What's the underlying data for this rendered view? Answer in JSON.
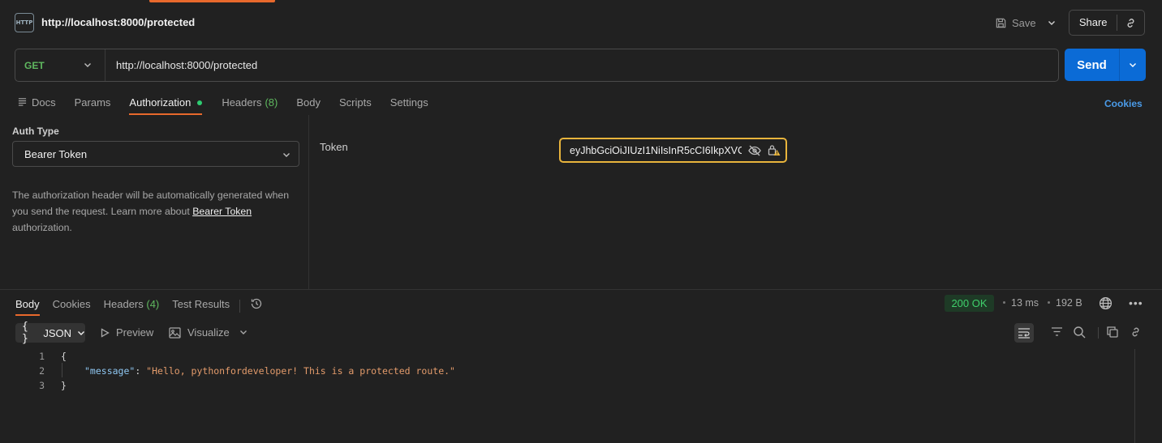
{
  "title_bar": {
    "icon_label": "HTTP",
    "request_name": "http://localhost:8000/protected",
    "save_label": "Save",
    "share_label": "Share"
  },
  "url_bar": {
    "method": "GET",
    "url": "http://localhost:8000/protected",
    "send_label": "Send"
  },
  "request_tabs": [
    {
      "label": "Docs"
    },
    {
      "label": "Params"
    },
    {
      "label": "Authorization"
    },
    {
      "label": "Headers",
      "count": "(8)"
    },
    {
      "label": "Body"
    },
    {
      "label": "Scripts"
    },
    {
      "label": "Settings"
    }
  ],
  "active_request_tab": "Authorization",
  "cookies_link": "Cookies",
  "auth": {
    "type_label": "Auth Type",
    "type_value": "Bearer Token",
    "desc_part1": "The authorization header will be automatically generated when you send the request. Learn more about ",
    "desc_link": "Bearer Token",
    "desc_part2": " authorization.",
    "token_label": "Token",
    "token_value": "eyJhbGciOiJIUzI1NiIsInR5cCI6IkpXVC"
  },
  "response_tabs": [
    {
      "label": "Body"
    },
    {
      "label": "Cookies"
    },
    {
      "label": "Headers",
      "count": "(4)"
    },
    {
      "label": "Test Results"
    }
  ],
  "active_response_tab": "Body",
  "response_meta": {
    "status": "200 OK",
    "time": "13 ms",
    "size": "192 B"
  },
  "response_toolbar": {
    "format": "JSON",
    "format_braces": "{ }",
    "preview_label": "Preview",
    "visualize_label": "Visualize"
  },
  "response_body": {
    "lines": [
      {
        "no": "1",
        "text": "{"
      },
      {
        "no": "2",
        "key": "\"message\"",
        "value": "\"Hello, pythonfordeveloper! This is a protected route.\""
      },
      {
        "no": "3",
        "text": "}"
      }
    ]
  },
  "colors": {
    "accent": "#e8692c",
    "send": "#0b6bd6",
    "method_get": "#5fb85f",
    "status_ok": "#3fcf6b"
  }
}
